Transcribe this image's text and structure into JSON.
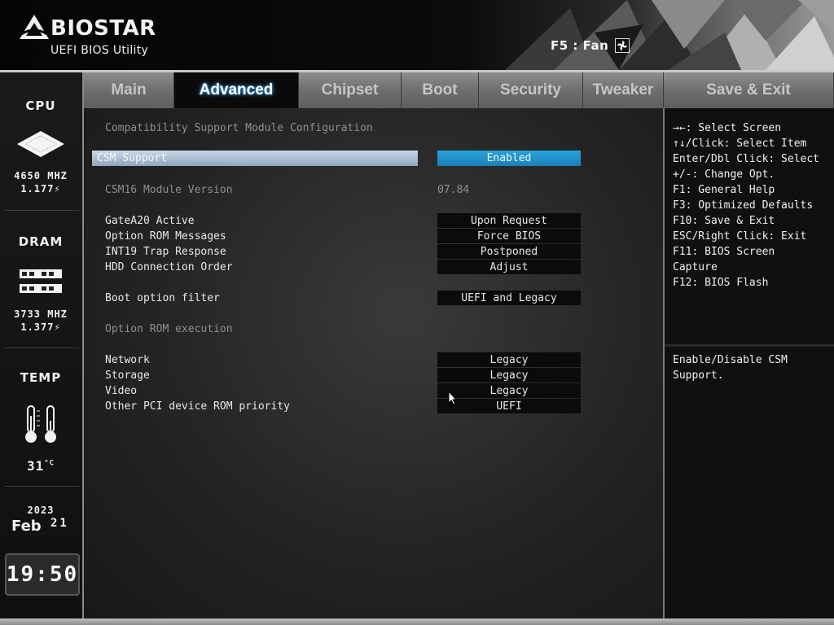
{
  "header": {
    "brand": "BIOSTAR",
    "subtitle": "UEFI BIOS Utility",
    "fan_hint": "F5 : Fan"
  },
  "sidebar": {
    "cpu": {
      "title": "CPU",
      "freq": "4650 MHZ",
      "volt": "1.177"
    },
    "dram": {
      "title": "DRAM",
      "freq": "3733 MHZ",
      "volt": "1.377"
    },
    "temp": {
      "title": "TEMP",
      "value": "31",
      "unit": "°C"
    },
    "date": {
      "year": "2023",
      "month": "Feb",
      "day": "21"
    },
    "clock": "19:50"
  },
  "tabs": [
    "Main",
    "Advanced",
    "Chipset",
    "Boot",
    "Security",
    "Tweaker",
    "Save & Exit"
  ],
  "active_tab": "Advanced",
  "page": {
    "title": "Compatibility Support Module Configuration",
    "csm_support": {
      "label": "CSM Support",
      "value": "Enabled"
    },
    "csm16_version": {
      "label": "CSM16 Module Version",
      "value": "07.84"
    },
    "settings": [
      {
        "label": "GateA20 Active",
        "value": "Upon Request"
      },
      {
        "label": "Option ROM Messages",
        "value": "Force BIOS"
      },
      {
        "label": "INT19 Trap Response",
        "value": "Postponed"
      },
      {
        "label": "HDD Connection Order",
        "value": "Adjust"
      }
    ],
    "boot_filter": {
      "label": "Boot option filter",
      "value": "UEFI and Legacy"
    },
    "option_rom_header": "Option ROM execution",
    "rom_settings": [
      {
        "label": "Network",
        "value": "Legacy"
      },
      {
        "label": "Storage",
        "value": "Legacy"
      },
      {
        "label": "Video",
        "value": "Legacy"
      },
      {
        "label": "Other PCI device ROM priority",
        "value": "UEFI"
      }
    ]
  },
  "help": {
    "keys": [
      "→←: Select Screen",
      "↑↓/Click: Select Item",
      "Enter/Dbl Click: Select",
      "+/-: Change Opt.",
      "F1: General Help",
      "F3: Optimized Defaults",
      "F10: Save & Exit",
      "ESC/Right Click: Exit",
      "F11: BIOS Screen",
      "Capture",
      "F12: BIOS Flash"
    ],
    "description": [
      "Enable/Disable CSM",
      "Support."
    ]
  },
  "colors": {
    "accent": "#1f8fcc",
    "highlight_row": "#b2c4d6",
    "active_tab_glow": "#4aa3e6"
  }
}
